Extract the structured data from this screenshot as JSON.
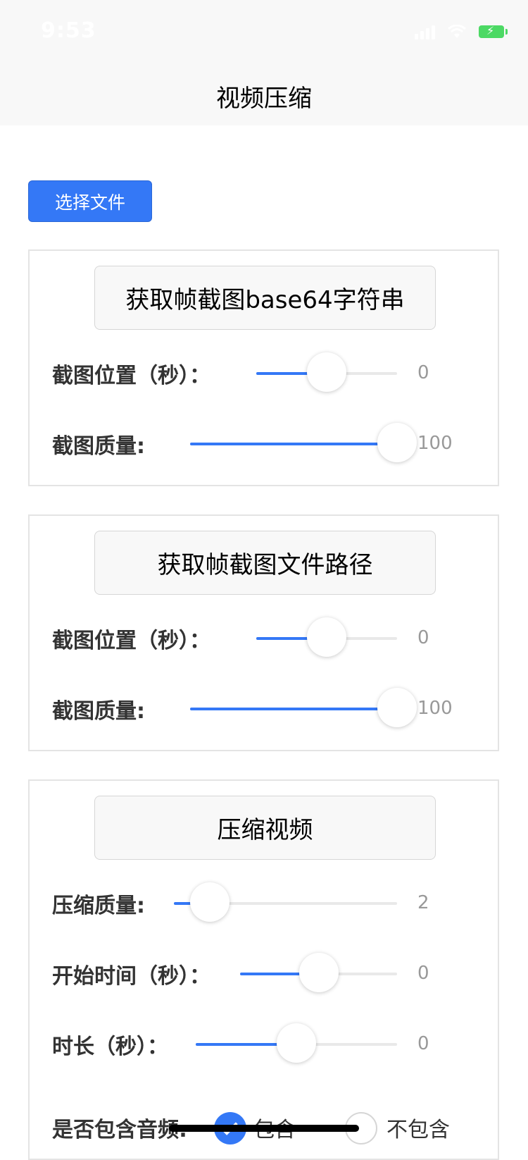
{
  "status_bar": {
    "time": "9:53",
    "battery": "charging"
  },
  "nav": {
    "title": "视频压缩"
  },
  "select_file_label": "选择文件",
  "panel_base64": {
    "button_label": "获取帧截图base64字符串",
    "position": {
      "label": "截图位置（秒）：",
      "value": "0",
      "level": 0.5
    },
    "quality": {
      "label": "截图质量:",
      "value": "100",
      "level": 1.0
    }
  },
  "panel_path": {
    "button_label": "获取帧截图文件路径",
    "position": {
      "label": "截图位置（秒）：",
      "value": "0",
      "level": 0.5
    },
    "quality": {
      "label": "截图质量:",
      "value": "100",
      "level": 1.0
    }
  },
  "panel_compress": {
    "button_label": "压缩视频",
    "quality": {
      "label": "压缩质量:",
      "value": "2",
      "level": 0.16
    },
    "start_time": {
      "label": "开始时间（秒）：",
      "value": "0",
      "level": 0.5
    },
    "duration": {
      "label": "时长（秒）：",
      "value": "0",
      "level": 0.5
    },
    "audio": {
      "label": "是否包含音频:",
      "options": [
        "包含",
        "不包含"
      ],
      "selected": "包含"
    }
  },
  "colors": {
    "accent": "#3478f6",
    "nav_background": "#f8f8f8",
    "track": "#e9e9e9"
  }
}
